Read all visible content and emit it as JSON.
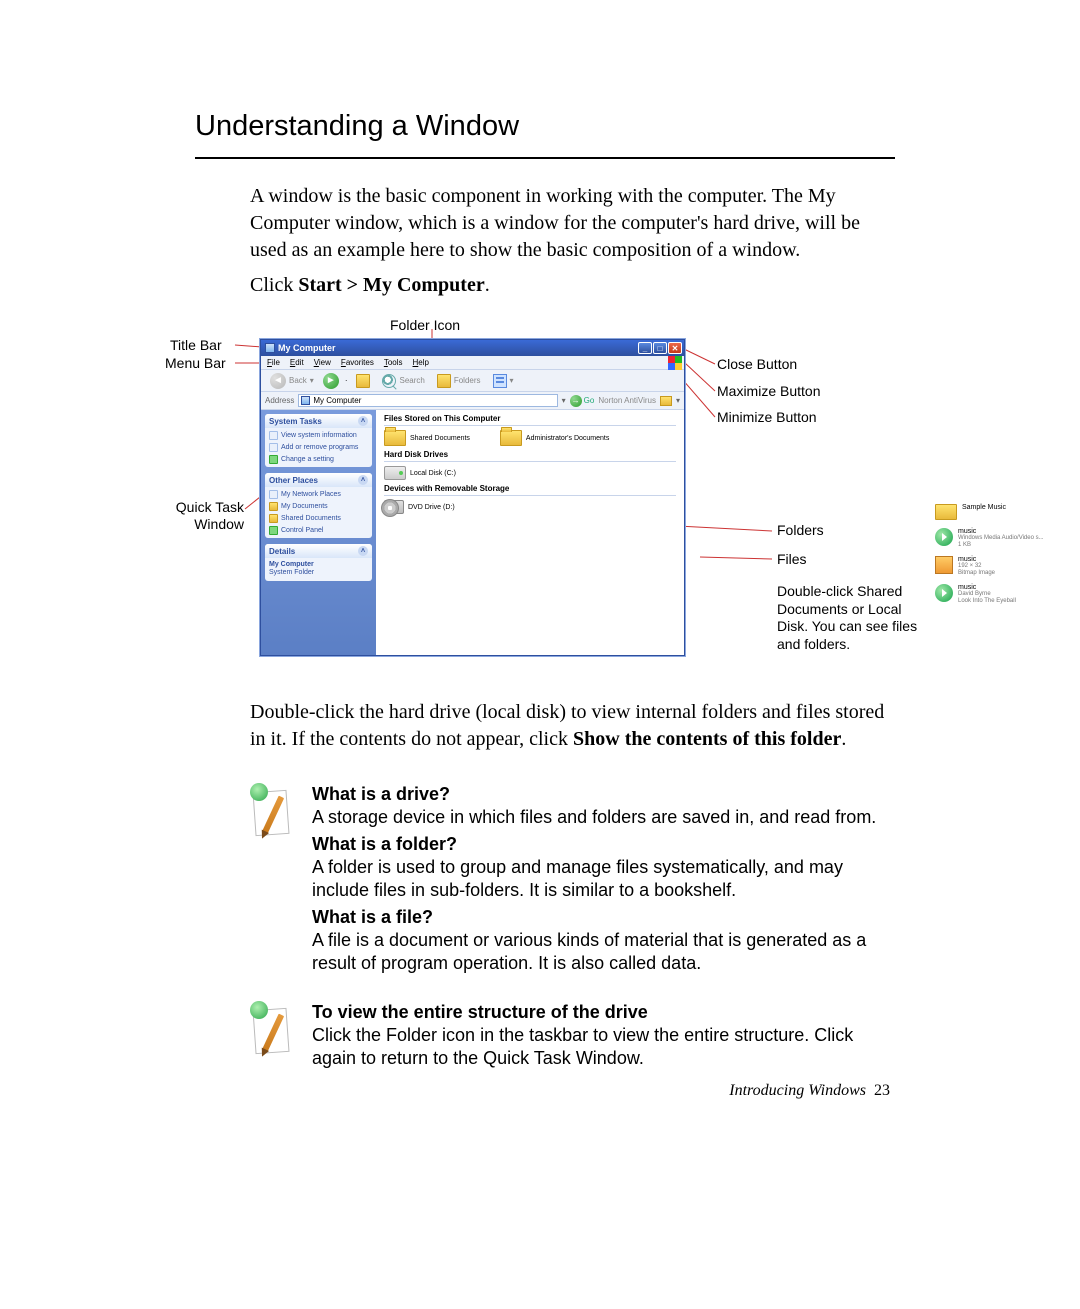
{
  "heading": "Understanding a Window",
  "intro": "A window is the basic component in working with the computer. The My Computer window, which is a window for the computer's hard drive, will be used as an example here to show the basic composition of a window.",
  "click_prefix": "Click ",
  "click_bold": "Start > My Computer",
  "diagram_labels": {
    "folder_icon": "Folder Icon",
    "title_bar": "Title Bar",
    "menu_bar": "Menu Bar",
    "quick_task": "Quick Task Window",
    "close_btn": "Close Button",
    "max_btn": "Maximize Button",
    "min_btn": "Minimize Button",
    "folders": "Folders",
    "files": "Files",
    "doubleclick": "Double-click Shared Documents or Local Disk. You can see files and folders."
  },
  "window": {
    "title": "My Computer",
    "menu": [
      "File",
      "Edit",
      "View",
      "Favorites",
      "Tools",
      "Help"
    ],
    "toolbar": {
      "back": "Back",
      "search": "Search",
      "folders": "Folders"
    },
    "address_label": "Address",
    "address_value": "My Computer",
    "go": "Go",
    "norton": "Norton AntiVirus",
    "sidebar": {
      "system_tasks": {
        "title": "System Tasks",
        "items": [
          "View system information",
          "Add or remove programs",
          "Change a setting"
        ]
      },
      "other_places": {
        "title": "Other Places",
        "items": [
          "My Network Places",
          "My Documents",
          "Shared Documents",
          "Control Panel"
        ]
      },
      "details": {
        "title": "Details",
        "name": "My Computer",
        "type": "System Folder"
      }
    },
    "content": {
      "h1": "Files Stored on This Computer",
      "row1": [
        "Shared Documents",
        "Administrator's Documents"
      ],
      "h2": "Hard Disk Drives",
      "row2": [
        "Local Disk (C:)"
      ],
      "h3": "Devices with Removable Storage",
      "row3": [
        "DVD Drive (D:)"
      ]
    },
    "extras": [
      {
        "name": "Sample Music",
        "kind": "folder"
      },
      {
        "name": "music",
        "sub": "Windows Media Audio/Video s...",
        "size": "1 KB",
        "kind": "media"
      },
      {
        "name": "music",
        "sub": "192 × 32",
        "type": "Bitmap Image",
        "kind": "image"
      },
      {
        "name": "music",
        "sub": "David Byrne",
        "type": "Look Into The Eyeball",
        "kind": "media"
      }
    ]
  },
  "lower": {
    "p1a": "Double-click the hard drive (local disk) to view internal folders and files stored in it. If the contents do not appear, click ",
    "p1b": "Show the contents of this folder",
    "p1c": "."
  },
  "notes": [
    {
      "q1": "What is a drive?",
      "a1": "A storage device in which files and folders are saved in, and read from.",
      "q2": "What is a folder?",
      "a2": "A folder is used to group and manage files systematically, and may include files in sub-folders. It is similar to a bookshelf.",
      "q3": "What is a file?",
      "a3": "A file is a document or various kinds of material that is generated as a result of program operation. It is also called data."
    },
    {
      "q1": "To view the entire structure of the drive",
      "a1": "Click the Folder icon in the taskbar to view the entire structure. Click again to return to the Quick Task Window."
    }
  ],
  "footer": {
    "text": "Introducing Windows",
    "page": "23"
  }
}
